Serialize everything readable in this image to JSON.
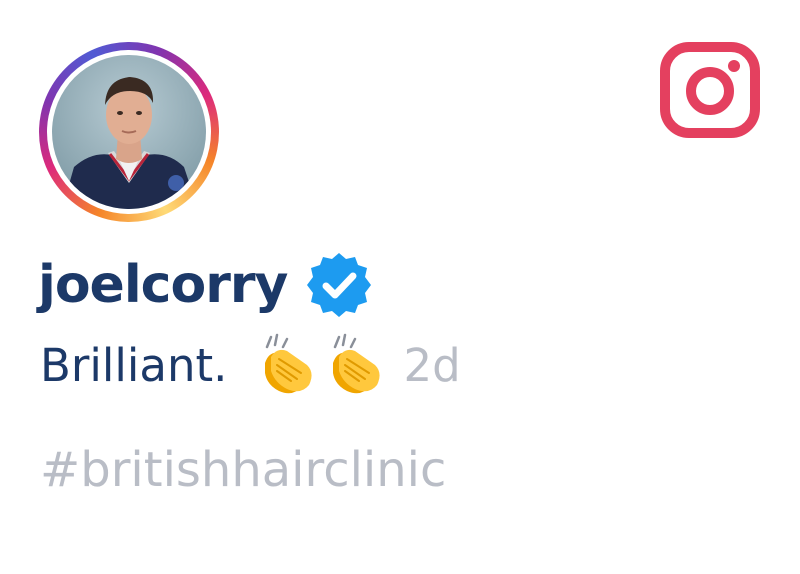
{
  "post": {
    "username": "joelcorry",
    "verified": true,
    "comment": "Brilliant.",
    "emojis": [
      "clapping-hands-icon",
      "clapping-hands-icon"
    ],
    "time_ago": "2d",
    "hashtag": "#britishhairclinic"
  },
  "icons": {
    "platform": "instagram-icon",
    "badge": "verified-badge-icon"
  },
  "colors": {
    "username": "#1c3968",
    "muted": "#b9bdc6",
    "instagram": "#e4405f",
    "verified": "#1d9bf0"
  }
}
